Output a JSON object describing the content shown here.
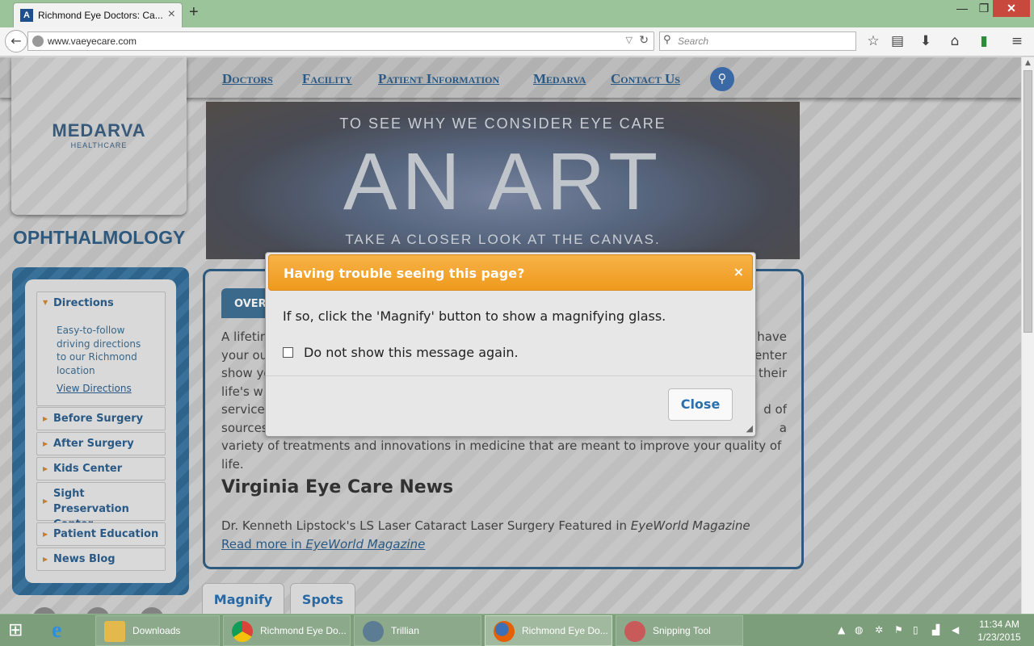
{
  "browser": {
    "tab_title": "Richmond Eye Doctors: Ca...",
    "tab_close": "×",
    "new_tab": "+",
    "url": "www.vaeyecare.com",
    "search_placeholder": "Search",
    "window_controls": {
      "minimize": "—",
      "maximize": "❐",
      "close": "✕"
    }
  },
  "site": {
    "logo": "MEDARVA",
    "logo_sub": "HEALTHCARE",
    "section_title": "OPHTHALMOLOGY",
    "nav": [
      "Doctors",
      "Facility",
      "Patient Information",
      "Medarva",
      "Contact Us"
    ],
    "hero": {
      "top": "TO SEE WHY WE CONSIDER EYE CARE",
      "main": "AN ART",
      "bottom": "TAKE A CLOSER LOOK AT THE CANVAS."
    }
  },
  "sidebar": {
    "directions": {
      "label": "Directions",
      "desc": "Easy-to-follow driving directions to our Richmond location",
      "link": "View Directions"
    },
    "items": [
      {
        "label": "Before Surgery"
      },
      {
        "label": "After Surgery"
      },
      {
        "label": "Kids Center"
      },
      {
        "label": "Sight Preservation Center"
      },
      {
        "label": "Patient Education"
      },
      {
        "label": "News Blog"
      }
    ]
  },
  "content": {
    "tab_label": "OVER",
    "paragraph": "A lifetime of healthy vision is our goal for every patient. We have your ou... center show yo... their life's w... services ... d of sources ... a variety of treatments and innovations in medicine that are meant to improve your quality of life.",
    "para_lines": [
      {
        "left": "A lifetim",
        "right": "have"
      },
      {
        "left": "your ou",
        "right": "enter"
      },
      {
        "left": "show yo",
        "right": "their"
      },
      {
        "left": "life's w",
        "right": ""
      },
      {
        "left": "services",
        "right": "d of"
      },
      {
        "left": "sources",
        "right": "a"
      }
    ],
    "last_line": "variety of treatments and innovations in medicine that are meant to improve your quality of life.",
    "news_title": "Virginia Eye Care News",
    "news_text": "Dr. Kenneth Lipstock's LS Laser Cataract Laser Surgery Featured in",
    "news_mag": "EyeWorld Magazine",
    "news_link": "Read more in",
    "news_link_mag": "EyeWorld Magazine"
  },
  "tools": {
    "magnify": "Magnify",
    "spots": "Spots"
  },
  "modal": {
    "title": "Having trouble seeing this page?",
    "close_x": "×",
    "message": "If so, click the 'Magnify' button to show a magnifying glass.",
    "checkbox_label": "Do not show this message again.",
    "checkbox_checked": false,
    "close_button": "Close",
    "header_color": "#f0a030"
  },
  "taskbar": {
    "tasks": [
      {
        "label": "Downloads"
      },
      {
        "label": "Richmond Eye Do..."
      },
      {
        "label": "Trillian"
      },
      {
        "label": "Richmond Eye Do..."
      },
      {
        "label": "Snipping Tool"
      }
    ],
    "time": "11:34 AM",
    "date": "1/23/2015"
  }
}
